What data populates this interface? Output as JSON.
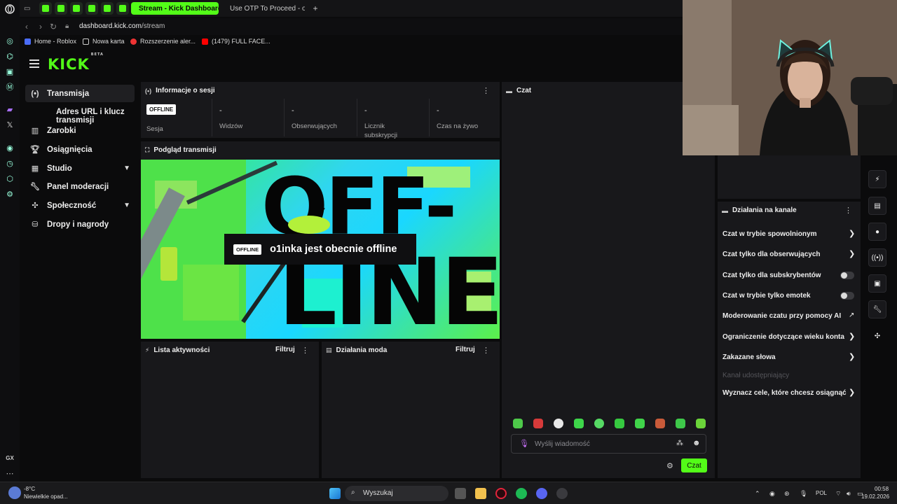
{
  "browser": {
    "tabs": [
      {
        "label": "Stream - Kick Dashboard",
        "active": true
      },
      {
        "label": "Use OTP To Proceed - ola...",
        "active": false
      }
    ],
    "url_domain": "dashboard.kick.com",
    "url_path": "/stream",
    "bookmarks": [
      "Home - Roblox",
      "Nowa karta",
      "Rozszerzenie aler...",
      "(1479) FULL FACE..."
    ]
  },
  "app": {
    "logo": "KICK",
    "logo_badge": "BETA",
    "accent": "#53fc18"
  },
  "sidebar": {
    "items": [
      {
        "label": "Transmisja",
        "icon": "broadcast-icon"
      },
      {
        "label": "Adres URL i klucz transmisji",
        "icon": ""
      },
      {
        "label": "Zarobki",
        "icon": "chart-icon"
      },
      {
        "label": "Osiągnięcia",
        "icon": "trophy-icon"
      },
      {
        "label": "Studio",
        "icon": "studio-icon"
      },
      {
        "label": "Panel moderacji",
        "icon": "wrench-icon"
      },
      {
        "label": "Społeczność",
        "icon": "community-icon"
      },
      {
        "label": "Dropy i nagrody",
        "icon": "drops-icon"
      }
    ]
  },
  "session": {
    "title": "Informacje o sesji",
    "badge": "OFFLINE",
    "stats": [
      {
        "value": "",
        "label": "Sesja"
      },
      {
        "value": "-",
        "label": "Widzów"
      },
      {
        "value": "-",
        "label": "Obserwujących"
      },
      {
        "value": "-",
        "label": "Licznik subskrypcji"
      },
      {
        "value": "-",
        "label": "Czas na żywo"
      }
    ]
  },
  "preview": {
    "title": "Podgląd transmisji",
    "badge": "OFFLINE",
    "message": "o1inka jest obecnie offline"
  },
  "activity": {
    "title": "Lista aktywności",
    "filter": "Filtruj"
  },
  "modactions": {
    "title": "Działania moda",
    "filter": "Filtruj"
  },
  "chat": {
    "title": "Czat",
    "placeholder": "Wyślij wiadomość",
    "send": "Czat"
  },
  "channel_actions": {
    "title": "Działania na kanale",
    "items": [
      {
        "label": "Czat w trybie spowolnionym",
        "control": "chevron"
      },
      {
        "label": "Czat tylko dla obserwujących",
        "control": "chevron"
      },
      {
        "label": "Czat tylko dla subskrybentów",
        "control": "toggle"
      },
      {
        "label": "Czat w trybie tylko emotek",
        "control": "toggle"
      },
      {
        "label": "Moderowanie czatu przy pomocy AI",
        "control": "external"
      },
      {
        "label": "Ograniczenie dotyczące wieku konta",
        "control": "chevron"
      },
      {
        "label": "Zakazane słowa",
        "control": "chevron"
      },
      {
        "label": "Kanał udostępniający",
        "control": "none"
      },
      {
        "label": "Wyznacz cele, które chcesz osiągnąć",
        "control": "chevron"
      }
    ]
  },
  "taskbar": {
    "weather_temp": "-8°C",
    "weather_desc": "Niewielkie opad...",
    "search": "Wyszukaj",
    "lang": "POL",
    "time": "00:58",
    "date": "19.02.2026"
  }
}
